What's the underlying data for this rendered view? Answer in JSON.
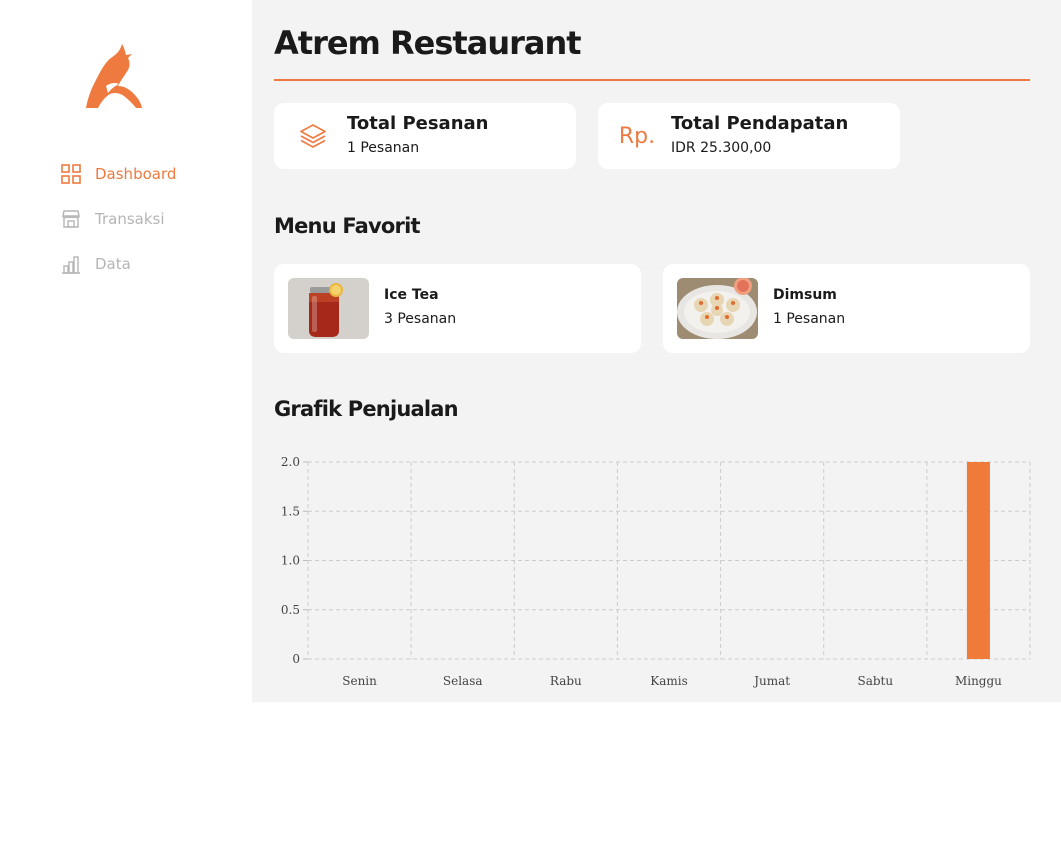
{
  "colors": {
    "accent": "#EE7A3F",
    "background": "#F3F3F3",
    "card": "#FFFFFF",
    "muted": "#B5B5B5"
  },
  "sidebar": {
    "logo_icon": "bull-head-logo",
    "items": [
      {
        "label": "Dashboard",
        "icon": "grid-icon",
        "active": true
      },
      {
        "label": "Transaksi",
        "icon": "store-icon",
        "active": false
      },
      {
        "label": "Data",
        "icon": "bar-chart-icon",
        "active": false
      }
    ]
  },
  "header": {
    "title": "Atrem Restaurant"
  },
  "stats": [
    {
      "title": "Total Pesanan",
      "value": "1 Pesanan",
      "icon": "layers-icon"
    },
    {
      "title": "Total Pendapatan",
      "value": "IDR 25.300,00",
      "icon_text": "Rp."
    }
  ],
  "favorites": {
    "title": "Menu Favorit",
    "items": [
      {
        "name": "Ice Tea",
        "count": "3 Pesanan",
        "image": "ice-tea-photo"
      },
      {
        "name": "Dimsum",
        "count": "1 Pesanan",
        "image": "dimsum-photo"
      }
    ]
  },
  "sales": {
    "title": "Grafik Penjualan"
  },
  "chart_data": {
    "type": "bar",
    "categories": [
      "Senin",
      "Selasa",
      "Rabu",
      "Kamis",
      "Jumat",
      "Sabtu",
      "Minggu"
    ],
    "values": [
      0,
      0,
      0,
      0,
      0,
      0,
      2
    ],
    "ylim": [
      0,
      2
    ],
    "yticks": [
      0,
      0.5,
      1,
      1.5,
      2
    ],
    "ytick_labels": [
      "0",
      "0.5",
      "1.0",
      "1.5",
      "2.0"
    ],
    "grid": true,
    "bar_color": "#F07A3A"
  }
}
